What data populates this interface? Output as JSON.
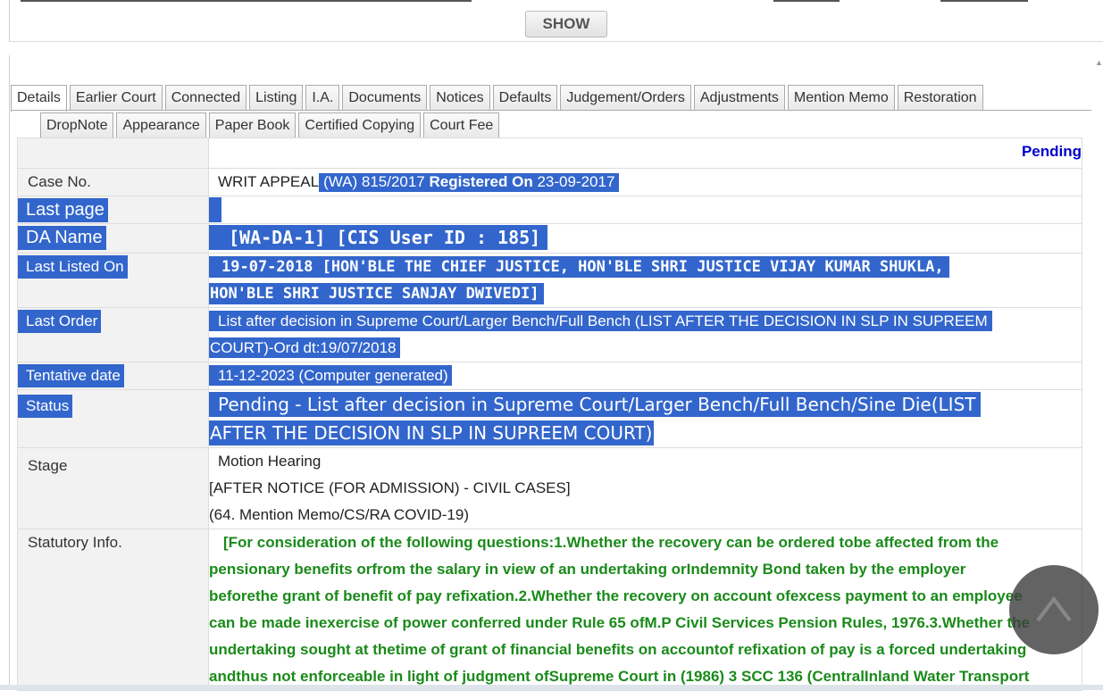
{
  "show_button": "SHOW",
  "tabs_row1": [
    "Details",
    "Earlier Court",
    "Connected",
    "Listing",
    "I.A.",
    "Documents",
    "Notices",
    "Defaults",
    "Judgement/Orders",
    "Adjustments",
    "Mention Memo",
    "Restoration"
  ],
  "tabs_row2": [
    "DropNote",
    "Appearance",
    "Paper Book",
    "Certified Copying",
    "Court Fee"
  ],
  "status_header": "Pending",
  "case": {
    "label": "Case No.",
    "type": "WRIT APPEAL",
    "number": "(WA) 815/2017",
    "registered_label": "Registered On",
    "registered_date": "23-09-2017"
  },
  "last_page": {
    "label": "Last page",
    "value": ""
  },
  "da_name": {
    "label": "DA Name",
    "value": "[WA-DA-1] [CIS User ID : 185]"
  },
  "last_listed": {
    "label": "Last Listed On",
    "line1": "19-07-2018 [HON'BLE THE CHIEF JUSTICE, HON'BLE SHRI JUSTICE VIJAY KUMAR SHUKLA,",
    "line2": "HON'BLE SHRI JUSTICE SANJAY DWIVEDI]"
  },
  "last_order": {
    "label": "Last Order",
    "line1": "List after decision in Supreme Court/Larger Bench/Full Bench (LIST AFTER THE DECISION IN SLP IN SUPREEM",
    "line2": "COURT)-Ord dt:19/07/2018"
  },
  "tentative": {
    "label": "Tentative date",
    "value": "11-12-2023 (Computer generated)"
  },
  "status": {
    "label": "Status",
    "line1": "Pending - List after decision in Supreme Court/Larger Bench/Full Bench/Sine Die(LIST",
    "line2": "AFTER THE DECISION IN SLP IN SUPREEM COURT)"
  },
  "stage": {
    "label": "Stage",
    "line1": "Motion Hearing",
    "line2": "[AFTER NOTICE (FOR ADMISSION) - CIVIL CASES]",
    "line3": "(64. Mention Memo/CS/RA COVID-19)"
  },
  "statutory": {
    "label": "Statutory Info.",
    "lines": [
      "[For consideration of the following questions:1.Whether the recovery can be ordered tobe affected from the",
      "pensionary benefits orfrom the salary in view of an undertaking orIndemnity Bond taken by the employer",
      "beforethe grant of benefit of pay refixation.2.Whether the recovery on account ofexcess payment to an employee",
      "can be made inexercise of power conferred under Rule 65 ofM.P Civil Services Pension Rules, 1976.3.Whether the",
      "undertaking sought at thetime of grant of financial benefits on accountof refixation of pay is a forced undertaking",
      "andthus not enforceable in light of judgment ofSupreme Court in (1986) 3 SCC 136 (CentralInland Water Transport"
    ]
  },
  "icons": {
    "scroll_top": "chevron-up-icon",
    "scroll_arrow": "triangle-up-icon"
  }
}
